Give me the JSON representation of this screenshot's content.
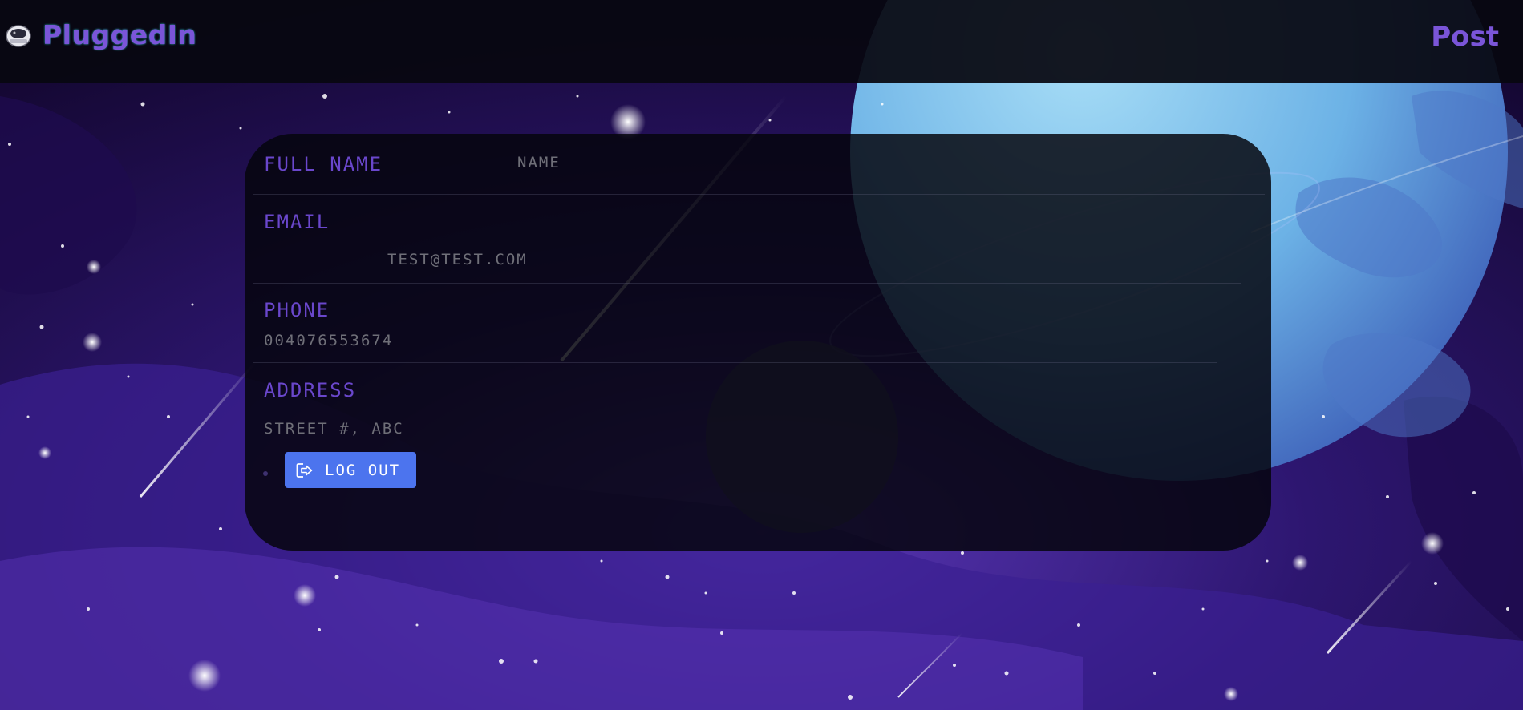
{
  "navbar": {
    "brand": "PluggedIn",
    "logo_icon": "astronaut-helmet-icon",
    "post_link": "Post"
  },
  "profile": {
    "full_name_label": "Full Name",
    "full_name_value": "Name",
    "email_label": "Email",
    "email_value": "test@test.com",
    "phone_label": "Phone",
    "phone_value": "004076553674",
    "address_label": "Address",
    "address_value": "Street #, ABC",
    "logout_label": "Log Out",
    "logout_icon": "sign-out-icon"
  },
  "colors": {
    "accent_purple": "#6a47cc",
    "button_blue": "#4c74ee",
    "navbar_bg": "#08080f",
    "card_bg": "#05050c"
  }
}
